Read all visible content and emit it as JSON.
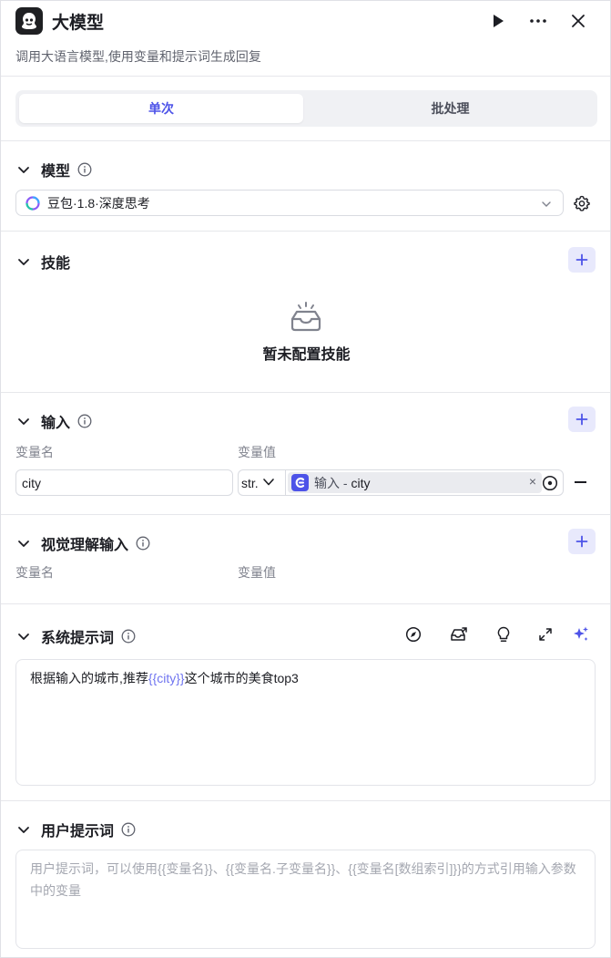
{
  "header": {
    "title": "大模型",
    "subtitle": "调用大语言模型,使用变量和提示词生成回复"
  },
  "tabs": [
    {
      "label": "单次",
      "active": true
    },
    {
      "label": "批处理",
      "active": false
    }
  ],
  "model_section": {
    "title": "模型",
    "selected_model": "豆包·1.8·深度思考"
  },
  "skills_section": {
    "title": "技能",
    "empty_text": "暂未配置技能"
  },
  "input_section": {
    "title": "输入",
    "col_name": "变量名",
    "col_value": "变量值",
    "rows": [
      {
        "name": "city",
        "type": "str.",
        "ref_source": "输入",
        "ref_separator": " - ",
        "ref_var": "city"
      }
    ]
  },
  "vision_section": {
    "title": "视觉理解输入",
    "col_name": "变量名",
    "col_value": "变量值"
  },
  "system_prompt": {
    "title": "系统提示词",
    "text_before": "根据输入的城市,推荐",
    "variable": "{{city}}",
    "text_after": "这个城市的美食top3"
  },
  "user_prompt": {
    "title": "用户提示词",
    "placeholder": "用户提示词，可以使用{{变量名}}、{{变量名.子变量名}}、{{变量名[数组索引]}}的方式引用输入参数中的变量"
  },
  "colors": {
    "accent": "#4d53e8",
    "accent_light": "#e8e9fc",
    "text": "#1c1d23",
    "muted": "#80838e"
  }
}
